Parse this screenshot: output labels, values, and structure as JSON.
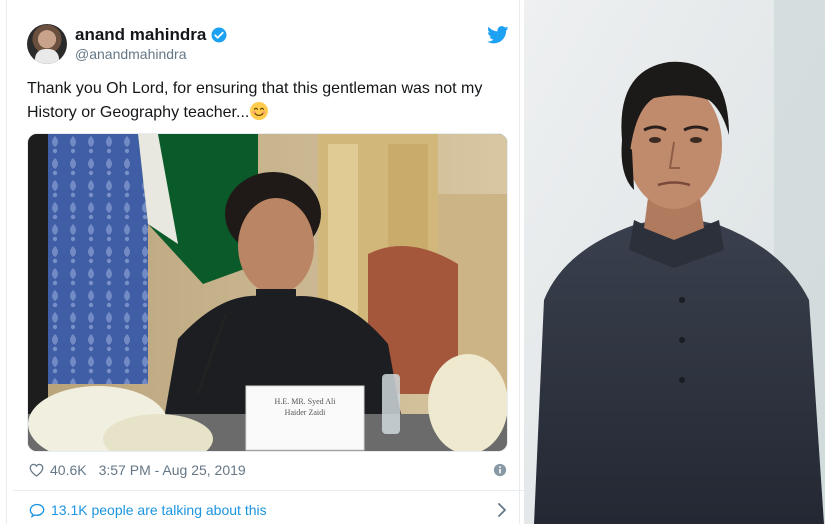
{
  "tweet": {
    "display_name": "anand mahindra",
    "handle": "@anandmahindra",
    "text_line1": "Thank you Oh Lord, for ensuring that this gentleman was not my",
    "text_line2": "History or Geography teacher...",
    "emoji": "smiling-face-with-smiling-eyes",
    "likes": "40.6K",
    "timestamp": "3:57 PM - Aug 25, 2019",
    "talking": "13.1K people are talking about this"
  },
  "video_placard": {
    "line1": "H.E. MR. Syed Ali",
    "line2": "Haider Zaidi"
  },
  "colors": {
    "brand_blue": "#1da1f2",
    "link_blue": "#1b95e0",
    "muted": "#657786",
    "border": "#e6ecf0"
  }
}
